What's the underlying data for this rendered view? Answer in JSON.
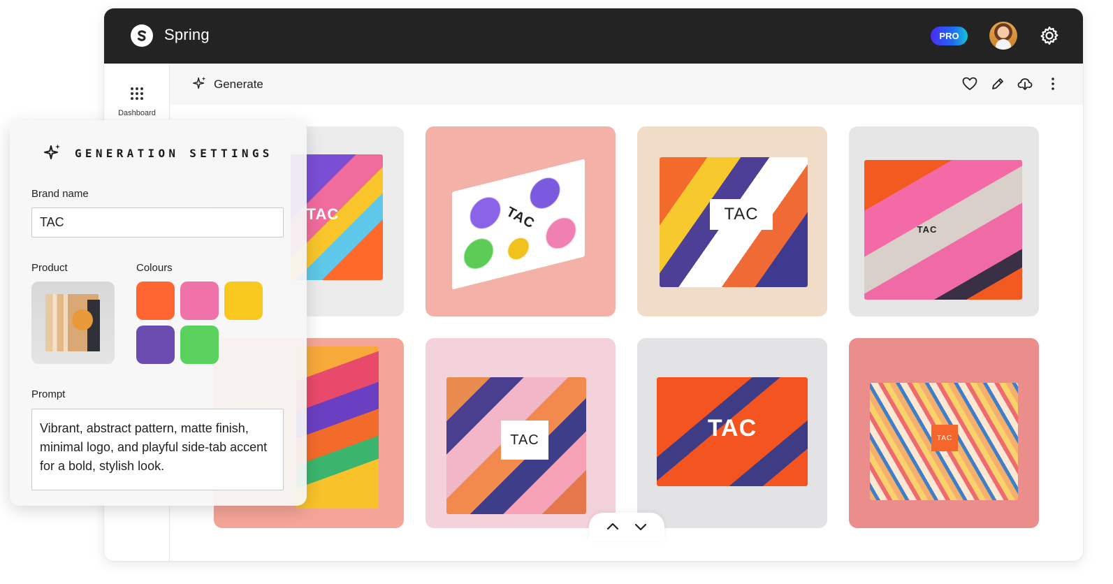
{
  "app": {
    "title": "Spring",
    "badge": "PRO"
  },
  "sidebar": {
    "items": [
      {
        "label": "Dashboard",
        "icon": "grid-dots-icon"
      }
    ]
  },
  "toolbar": {
    "title": "Generate",
    "actions": [
      {
        "name": "favorite",
        "icon": "heart-icon"
      },
      {
        "name": "edit",
        "icon": "pencil-icon"
      },
      {
        "name": "download",
        "icon": "cloud-download-icon"
      },
      {
        "name": "more",
        "icon": "more-vertical-icon"
      }
    ]
  },
  "gallery": {
    "items": [
      {
        "label": "TAC",
        "bg": "#ececec",
        "box": "#7a4fd6"
      },
      {
        "label": "TAC",
        "bg": "#f3b1a8",
        "box": "#ffffff"
      },
      {
        "label": "TAC",
        "bg": "#f1ddc7",
        "box": "#f36b2b"
      },
      {
        "label": "TAC",
        "bg": "#e6e6e6",
        "box": "#f35a1f"
      },
      {
        "label": "",
        "bg": "#f4a597",
        "box": "#f7a93a"
      },
      {
        "label": "TAC",
        "bg": "#f4d2db",
        "box": "#e98b4f"
      },
      {
        "label": "TAC",
        "bg": "#e3e3e5",
        "box": "#f4541f"
      },
      {
        "label": "TAC",
        "bg": "#eb8d8b",
        "box": "#f6b06d"
      }
    ]
  },
  "panel": {
    "title": "GENERATION SETTINGS",
    "brand_label": "Brand name",
    "brand_value": "TAC",
    "product_label": "Product",
    "colours_label": "Colours",
    "colours": [
      "#ff6530",
      "#ef72a8",
      "#f9c81f",
      "#6a4bb0",
      "#5bd15e"
    ],
    "prompt_label": "Prompt",
    "prompt_value": "Vibrant, abstract pattern, matte finish, minimal logo, and playful side-tab accent for a bold, stylish look."
  }
}
